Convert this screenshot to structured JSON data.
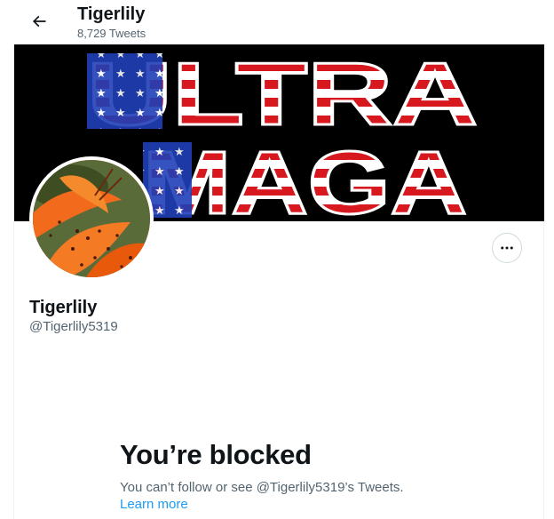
{
  "header": {
    "title": "Tigerlily",
    "tweet_count": "8,729 Tweets"
  },
  "banner": {
    "line1": "ULTRA",
    "line2": "MAGA"
  },
  "profile": {
    "name": "Tigerlily",
    "handle": "@Tigerlily5319"
  },
  "blocked": {
    "title": "You’re blocked",
    "message": "You can’t follow or see @Tigerlily5319’s Tweets.",
    "learn_more": "Learn more"
  },
  "colors": {
    "link": "#1d9bf0",
    "secondary_text": "#536471",
    "banner_red": "#d7191f",
    "banner_blue": "#1f3fb7"
  },
  "icons": {
    "back": "arrow-left-icon",
    "more": "more-horizontal-icon"
  }
}
